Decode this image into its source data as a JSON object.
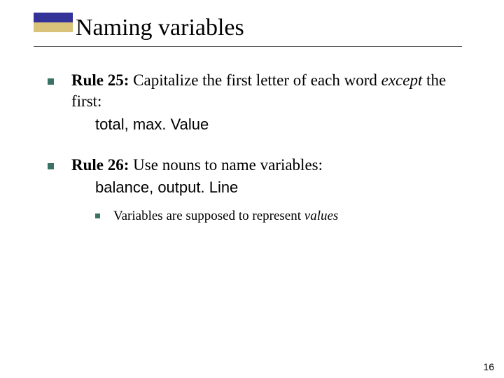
{
  "title": "Naming variables",
  "rules": [
    {
      "label": "Rule 25:",
      "text_1": " Capitalize the first letter of each word ",
      "em": "except",
      "text_2": " the first:",
      "code_1": "total",
      "sep": ", ",
      "code_2": "max. Value"
    },
    {
      "label": "Rule 26:",
      "text_1": " Use nouns to name variables:",
      "code_1": "balance",
      "sep": ", ",
      "code_2": "output. Line",
      "sub_text_1": "Variables are supposed to represent ",
      "sub_em": "values"
    }
  ],
  "page_number": "16"
}
